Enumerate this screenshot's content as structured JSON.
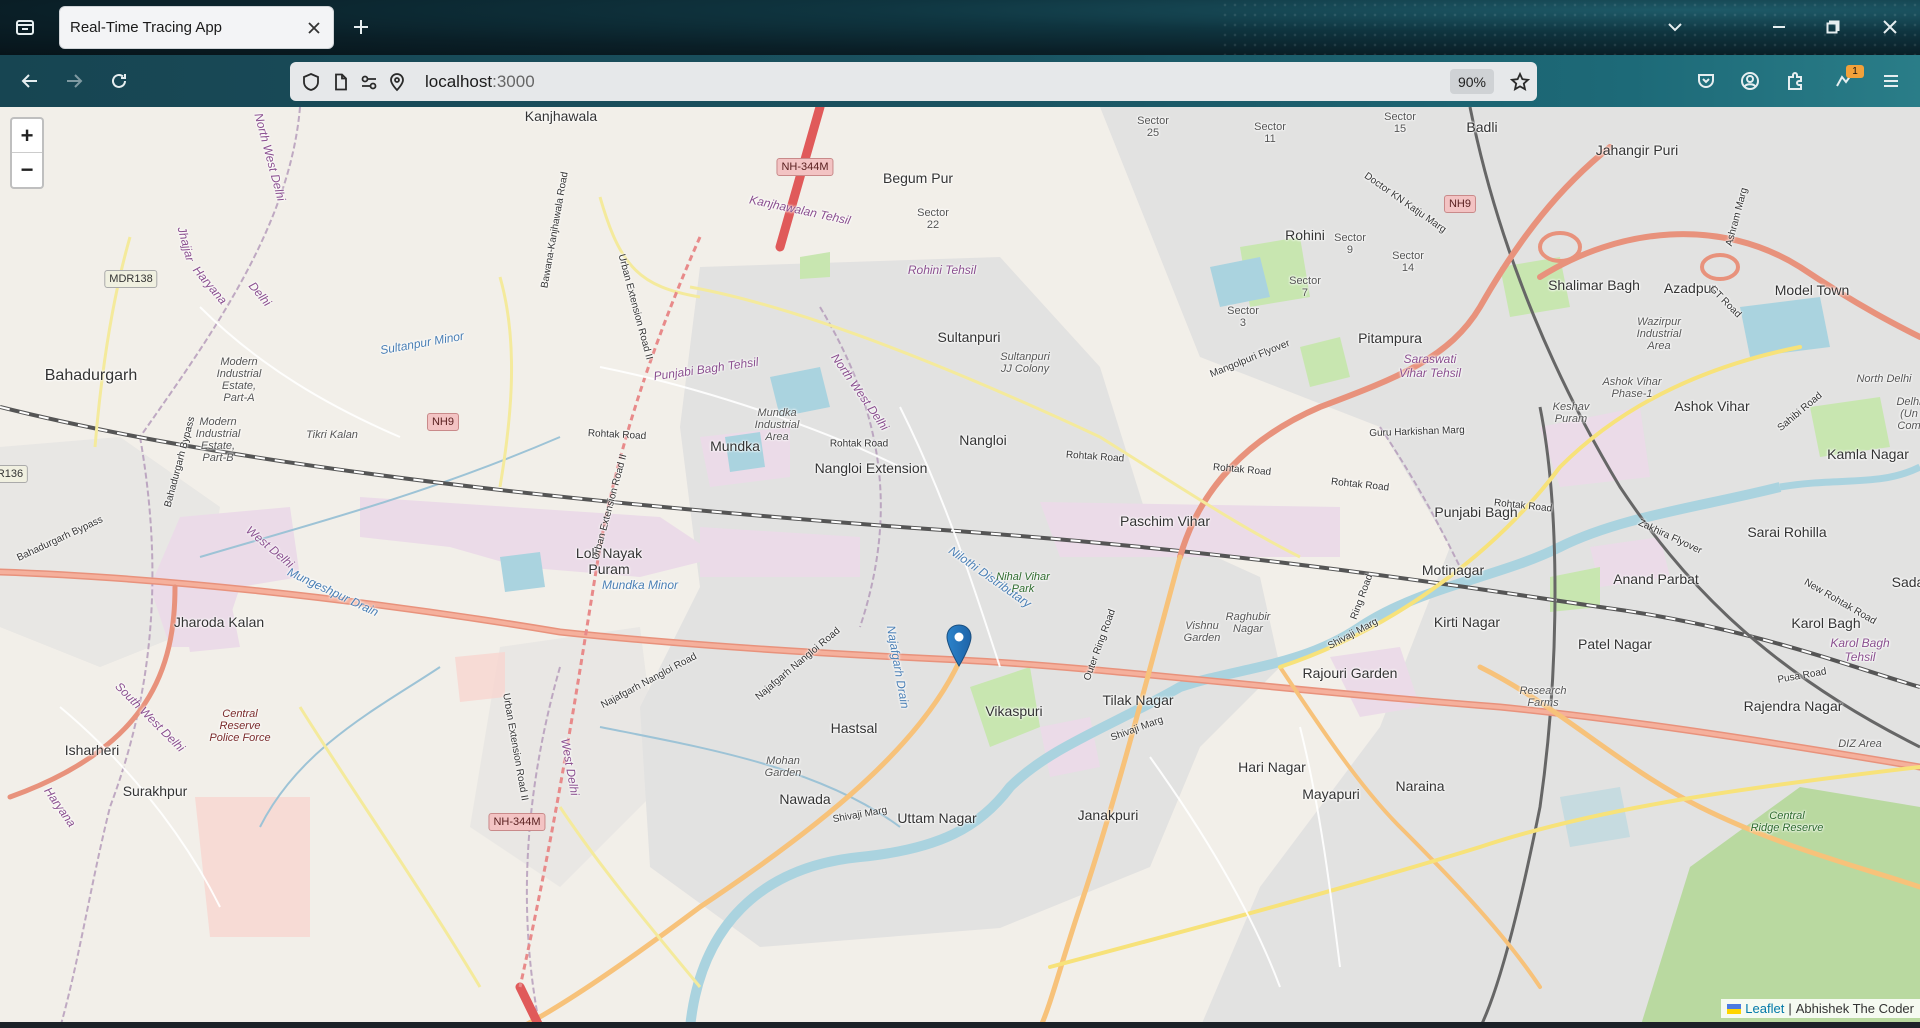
{
  "browser": {
    "tab_title": "Real-Time Tracing App",
    "url_host": "localhost",
    "url_port": ":3000",
    "zoom_level": "90%",
    "extension_badge": "1"
  },
  "map": {
    "zoom_in_label": "+",
    "zoom_out_label": "−",
    "attribution_link": "Leaflet",
    "attribution_separator": "|",
    "attribution_text": "Abhishek The Coder",
    "places": {
      "kanjhawala": "Kanjhawala",
      "begum_pur": "Begum Pur",
      "badli": "Badli",
      "jahangir_puri": "Jahangir Puri",
      "rohini": "Rohini",
      "sultanpuri": "Sultanpuri",
      "pitampura": "Pitampura",
      "shalimar_bagh": "Shalimar Bagh",
      "azadpur": "Azadpur",
      "model_town": "Model Town",
      "bahadurgarh": "Bahadurgarh",
      "mundka": "Mundka",
      "nangloi": "Nangloi",
      "nangloi_extension": "Nangloi Extension",
      "ashok_vihar": "Ashok Vihar",
      "kamla_nagar": "Kamla Nagar",
      "paschim_vihar": "Paschim Vihar",
      "punjabi_bagh": "Punjabi Bagh",
      "sarai_rohilla": "Sarai Rohilla",
      "lok_nayak_puram": "Lok Nayak\nPuram",
      "motinagar": "Motinagar",
      "anand_parbat": "Anand Parbat",
      "kirti_nagar": "Kirti Nagar",
      "karol_bagh": "Karol Bagh",
      "jharoda_kalan": "Jharoda Kalan",
      "patel_nagar": "Patel Nagar",
      "rajouri_garden": "Rajouri Garden",
      "tilak_nagar": "Tilak Nagar",
      "rajendra_nagar": "Rajendra Nagar",
      "vikaspuri": "Vikaspuri",
      "hastsal": "Hastsal",
      "isharheri": "Isharheri",
      "hari_nagar": "Hari Nagar",
      "surakhpur": "Surakhpur",
      "nawada": "Nawada",
      "mayapuri": "Mayapuri",
      "naraina": "Naraina",
      "uttam_nagar": "Uttam Nagar",
      "janakpuri": "Janakpuri",
      "sada": "Sada"
    },
    "minor_labels": {
      "sector_25": "Sector\n25",
      "sector_11": "Sector\n11",
      "sector_15": "Sector\n15",
      "sector_22": "Sector\n22",
      "sector_9": "Sector\n9",
      "sector_14": "Sector\n14",
      "sector_7": "Sector\n7",
      "sector_3": "Sector\n3",
      "sultanpuri_jj": "Sultanpuri\nJJ Colony",
      "modern_a": "Modern\nIndustrial\nEstate,\nPart-A",
      "modern_b": "Modern\nIndustrial\nEstate,\nPart-B",
      "tikri_kalan": "Tikri Kalan",
      "mundka_ind": "Mundka\nIndustrial\nArea",
      "wazirpur": "Wazirpur\nIndustrial\nArea",
      "ashok_vihar_1": "Ashok Vihar\nPhase-1",
      "keshav_puram": "Keshav\nPuram",
      "raghubir": "Raghubir\nNagar",
      "vishnu_garden": "Vishnu\nGarden",
      "research_farms": "Research\nFarms",
      "mohan_garden": "Mohan\nGarden",
      "dizarea": "DIZ Area",
      "north_delhi_tag": "North Delhi",
      "north_delhi_2": "North\nDelhi",
      "delhi_un": "Delhi\n(Un\nCom"
    },
    "purple_labels": {
      "rohini_tehsil": "Rohini Tehsil",
      "kanjhawala_tehsil": "Kanjhawalan Tehsil",
      "punjabi_bagh_tehsil": "Punjabi Bagh Tehsil",
      "saraswati": "Saraswati\nVihar Tehsil",
      "north_west_delhi": "North West Delhi",
      "north_west_delhi_2": "North West Delhi",
      "haryana": "Haryana",
      "delhi": "Delhi",
      "west_delhi": "West Delhi",
      "karol_bagh_tehsil": "Karol Bagh\nTehsil",
      "jhajjar": "Jhajjar",
      "south_west_delhi": "South West Delhi",
      "west_delhi_2": "West Delhi",
      "haryana_2": "Haryana"
    },
    "water_labels": {
      "sultanpur_minor": "Sultanpur Minor",
      "mungeshpur": "Mungeshpur Drain",
      "mundka_minor": "Mundka Minor",
      "nilothi": "Nilothi Distributary",
      "najafgarh_drain": "Najafgarh Drain"
    },
    "park_labels": {
      "nihal_vihar_park": "Nihal Vihar\nPark",
      "central_ridge": "Central\nRidge Reserve"
    },
    "red_labels": {
      "crpf": "Central\nReserve\nPolice Force"
    },
    "road_labels": {
      "rohtak_road_1": "Rohtak Road",
      "rohtak_road_2": "Rohtak Road",
      "rohtak_road_3": "Rohtak Road",
      "rohtak_road_4": "Rohtak Road",
      "rohtak_road_5": "Rohtak Road",
      "rohtak_road_6": "Rohtak Road",
      "guru_harkishan": "Guru Harkishan Marg",
      "najafgarh_nangloi": "Najafgarh Nangloi Road",
      "najafgarh_nangloi_2": "Najafgarh Nangloi Road",
      "outer_ring": "Outer Ring Road",
      "mangolpuri_flyover": "Mangolpuri Flyover",
      "kn_katju": "Doctor KN Katju Marg",
      "shivaji_marg": "Shivaji Marg",
      "shivaji_marg_2": "Shivaji Marg",
      "shivaji_marg_3": "Shivaji Marg",
      "bahadurgarh_bypass": "Bahadurgarh Bypass",
      "bahadurgarh_bypass_2": "Bahadurgarh Bypass",
      "urban_ext_1": "Urban Extension Road II",
      "urban_ext_2": "Urban Extension Road II",
      "urban_ext_3": "Urban Extension Road II",
      "bawana": "Bawana-Kanjhawala Road",
      "zakhira": "Zakhira Flyover",
      "new_rohtak": "New Rohtak Road",
      "pusa_road": "Pusa Road",
      "ring_road": "Ring Road",
      "ashram_marg": "Ashram Marg",
      "gt_road": "GT Road",
      "sahib_road": "Sahibi Road"
    },
    "shields": {
      "nh344m_top": "NH-344M",
      "nh344m_bottom": "NH-344M",
      "nh9_left": "NH9",
      "nh9_right": "NH9",
      "mdr138": "MDR138",
      "r136": "R136"
    }
  }
}
